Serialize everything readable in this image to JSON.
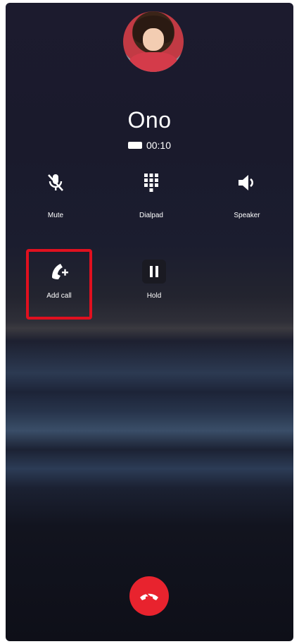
{
  "call": {
    "contact_name": "Ono",
    "duration": "00:10"
  },
  "controls": {
    "mute": "Mute",
    "dialpad": "Dialpad",
    "speaker": "Speaker",
    "add_call": "Add call",
    "hold": "Hold"
  },
  "colors": {
    "end_call": "#e8232e",
    "highlight": "#e0101f"
  }
}
